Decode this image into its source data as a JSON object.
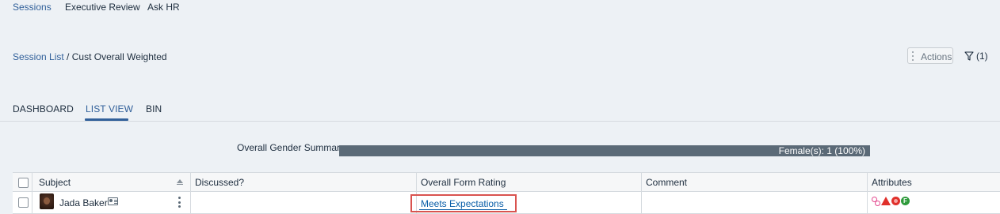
{
  "topnav": {
    "items": [
      {
        "label": "Sessions",
        "active": true
      },
      {
        "label": "Executive Review",
        "active": false
      },
      {
        "label": "Ask HR",
        "active": false
      }
    ]
  },
  "breadcrumb": {
    "link": "Session List",
    "separator": "/",
    "current": "Cust Overall Weighted"
  },
  "toolbar": {
    "actions_label": "Actions",
    "filter_label": "(1)"
  },
  "tabs": [
    {
      "label": "DASHBOARD",
      "active": false
    },
    {
      "label": "LIST VIEW",
      "active": true
    },
    {
      "label": "BIN",
      "active": false
    }
  ],
  "gender_summary": {
    "label": "Overall Gender Summary",
    "bar_text": "Female(s): 1 (100%)",
    "female_fraction": 1.0
  },
  "table": {
    "columns": [
      "Subject",
      "Discussed?",
      "Overall Form Rating",
      "Comment",
      "Attributes"
    ],
    "rows": [
      {
        "subject": "Jada Baker",
        "discussed": "",
        "rating": "Meets Expectations",
        "comment": "",
        "attribute_icons": [
          "people-icon",
          "warning-triangle-icon",
          "red-circle-icon",
          "green-f-icon"
        ],
        "attribute_f": "F"
      }
    ]
  },
  "colors": {
    "accent": "#31609a",
    "bar": "#5b6a77",
    "highlight_box": "#d9534f",
    "link": "#0a5ea8"
  }
}
